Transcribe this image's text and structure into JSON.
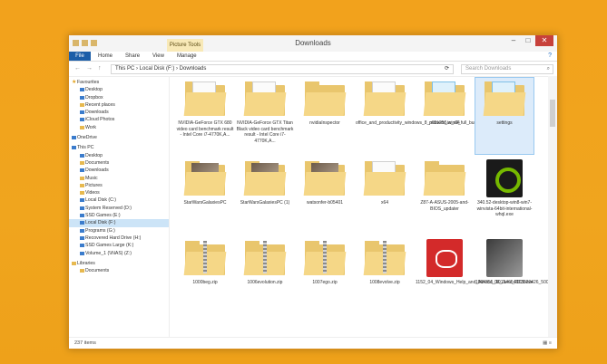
{
  "window": {
    "title": "Downloads",
    "context_tab": "Picture Tools",
    "controls": {
      "minimize": "–",
      "maximize": "□",
      "close": "✕"
    }
  },
  "ribbon": {
    "file": "File",
    "tabs": [
      "Home",
      "Share",
      "View",
      "Manage"
    ],
    "help": "?"
  },
  "nav": {
    "back": "←",
    "forward": "→",
    "up": "↑"
  },
  "address": {
    "path": "This PC  ›  Local Disk (F:)  ›  Downloads",
    "refresh": "⟳"
  },
  "search": {
    "placeholder": "Search Downloads",
    "icon": "search-icon"
  },
  "sidebar": {
    "favourites": {
      "label": "Favourites",
      "items": [
        "Desktop",
        "Dropbox",
        "Recent places",
        "Downloads",
        "iCloud Photos",
        "Work"
      ]
    },
    "onedrive": "OneDrive",
    "thispc": {
      "label": "This PC",
      "items": [
        "Desktop",
        "Documents",
        "Downloads",
        "Music",
        "Pictures",
        "Videos",
        "Local Disk (C:)",
        "System Reserved (D:)",
        "SSD Games (E:)",
        "Local Disk (F:)",
        "Programs (G:)",
        "Recovered Hard Drive (H:)",
        "SSD Games Large (K:)",
        "Volume_1 (\\\\NAS) (Z:)"
      ]
    },
    "libraries": {
      "label": "Libraries",
      "items": [
        "Documents"
      ]
    }
  },
  "files": [
    {
      "name": "NVIDIA-GeForce GTX 680 video card benchmark result - Intel Core i7-4770K,A...",
      "type": "folder-doc"
    },
    {
      "name": "NVIDIA-GeForce GTX Titan Black video card benchmark result - Intel Core i7-4770K,A...",
      "type": "folder-doc"
    },
    {
      "name": "nvidiaInspector",
      "type": "folder"
    },
    {
      "name": "office_and_productivity_windows_8_modern_to_all_full_bundled_cep3dfe4ef6d",
      "type": "folder-doc"
    },
    {
      "name": "p85v255.win64",
      "type": "folder-blue"
    },
    {
      "name": "settings",
      "type": "folder-blue",
      "selected": true
    },
    {
      "name": "StarWarsGalaxiesPC",
      "type": "folder-photo"
    },
    {
      "name": "StarWarsGalaxiesPC (1)",
      "type": "folder-photo"
    },
    {
      "name": "watsonfer-b05401",
      "type": "folder-photo"
    },
    {
      "name": "x64",
      "type": "folder-doc"
    },
    {
      "name": "Z87-A-ASUS-2005-and-BIOS_updater",
      "type": "folder"
    },
    {
      "name": "340.52-desktop-win8-win7-winvista-64bit-international-whql.exe",
      "type": "nvidia"
    },
    {
      "name": "1000beg.zip",
      "type": "zip"
    },
    {
      "name": "1006evolution.zip",
      "type": "zip"
    },
    {
      "name": "1007ego.zip",
      "type": "zip"
    },
    {
      "name": "1008evolve.zip",
      "type": "zip"
    },
    {
      "name": "1152_04_Windows_Help_and_Advice_08_June_2015.exe",
      "type": "network"
    },
    {
      "name": "1564355_10154654013820426_5002982969565558826_n.jpg",
      "type": "photo"
    }
  ],
  "status": {
    "items": "237 items",
    "views": "▦ ≡"
  },
  "colors": {
    "accent": "#1b5ea8",
    "close": "#c7413b",
    "folder": "#e9c66d",
    "background": "#f2a21c"
  }
}
